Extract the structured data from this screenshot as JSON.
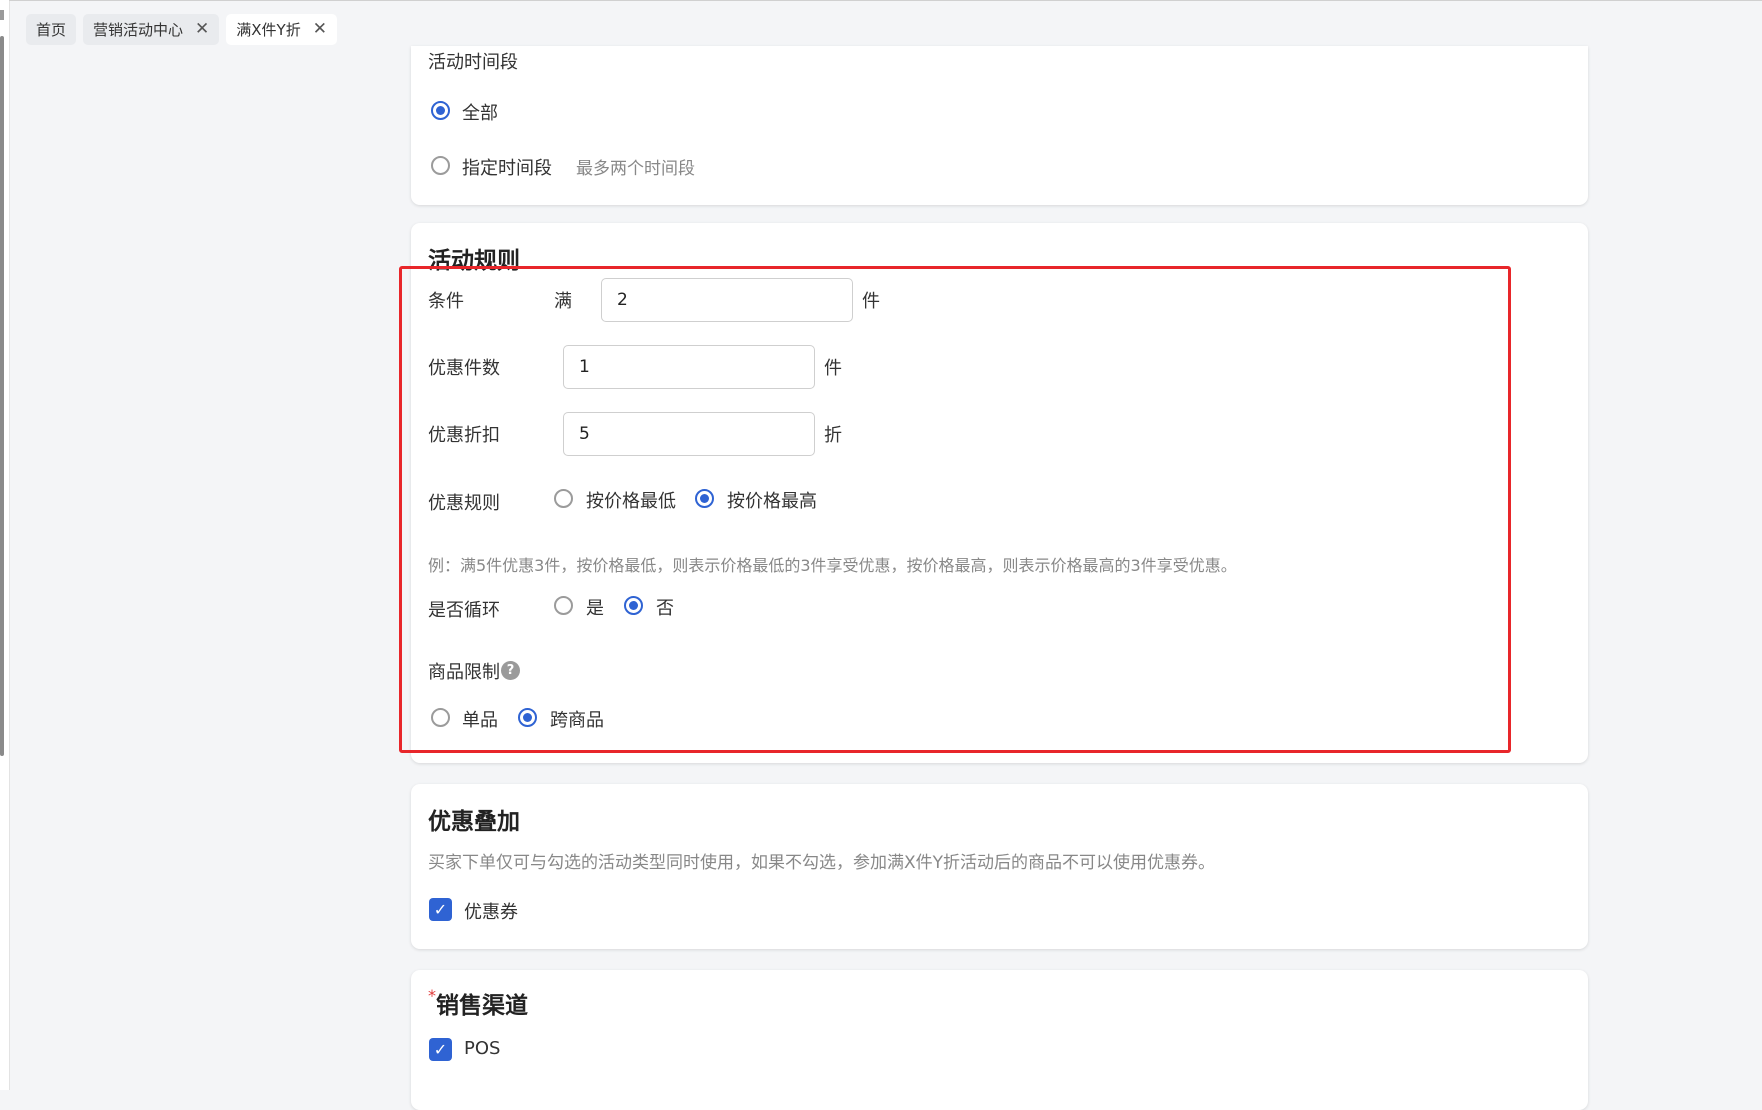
{
  "tabs": [
    {
      "label": "首页",
      "closable": false
    },
    {
      "label": "营销活动中心",
      "closable": true
    },
    {
      "label": "满X件Y折",
      "closable": true,
      "active": true
    }
  ],
  "close_glyph": "✕",
  "time_section": {
    "label": "活动时间段",
    "options": [
      {
        "label": "全部",
        "checked": true
      },
      {
        "label": "指定时间段",
        "checked": false
      }
    ],
    "hint": "最多两个时间段"
  },
  "rules": {
    "title": "活动规则",
    "condition": {
      "label": "条件",
      "prefix": "满",
      "value": "2",
      "unit": "件"
    },
    "discount_count": {
      "label": "优惠件数",
      "value": "1",
      "unit": "件"
    },
    "discount_rate": {
      "label": "优惠折扣",
      "value": "5",
      "unit": "折"
    },
    "discount_rule": {
      "label": "优惠规则",
      "options": [
        {
          "label": "按价格最低",
          "checked": false
        },
        {
          "label": "按价格最高",
          "checked": true
        }
      ]
    },
    "example": "例：满5件优惠3件，按价格最低，则表示价格最低的3件享受优惠，按价格最高，则表示价格最高的3件享受优惠。",
    "loop": {
      "label": "是否循环",
      "options": [
        {
          "label": "是",
          "checked": false
        },
        {
          "label": "否",
          "checked": true
        }
      ]
    },
    "product_limit": {
      "label": "商品限制",
      "help_glyph": "?",
      "options": [
        {
          "label": "单品",
          "checked": false
        },
        {
          "label": "跨商品",
          "checked": true
        }
      ]
    }
  },
  "stacking": {
    "title": "优惠叠加",
    "desc": "买家下单仅可与勾选的活动类型同时使用，如果不勾选，参加满X件Y折活动后的商品不可以使用优惠券。",
    "options": [
      {
        "label": "优惠券",
        "checked": true
      }
    ]
  },
  "channel": {
    "required_mark": "*",
    "title": "销售渠道",
    "options": [
      {
        "label": "POS",
        "checked": true
      }
    ]
  },
  "check_glyph": "✓",
  "colors": {
    "accent": "#2f63d3",
    "highlight": "#e8262a"
  }
}
